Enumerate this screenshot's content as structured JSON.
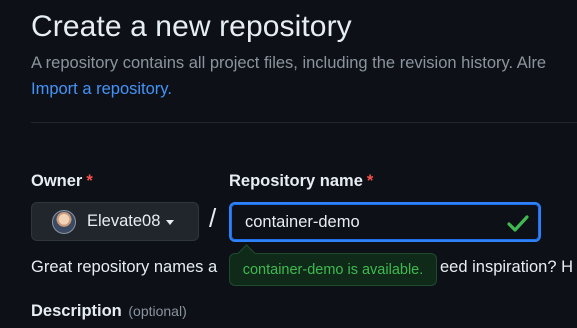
{
  "header": {
    "title": "Create a new repository",
    "subtitle": "A repository contains all project files, including the revision history. Alre",
    "import_link": "Import a repository."
  },
  "owner": {
    "label": "Owner",
    "required_mark": "*",
    "value": "Elevate08",
    "avatar_icon": "user-avatar"
  },
  "separator": "/",
  "repository": {
    "label": "Repository name",
    "required_mark": "*",
    "value": "container-demo",
    "status_icon": "check-icon"
  },
  "hint": {
    "left_text": "Great repository names a",
    "right_text": "eed inspiration? H"
  },
  "availability": {
    "message": "container-demo is available."
  },
  "description": {
    "label": "Description",
    "optional": "(optional)"
  },
  "colors": {
    "background": "#0d1117",
    "link": "#4493f8",
    "required": "#f85149",
    "success": "#3fb950",
    "focus_border": "#2f81f7"
  }
}
